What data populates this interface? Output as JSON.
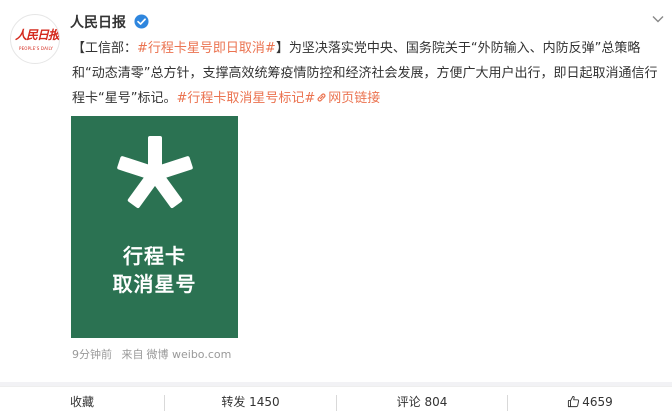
{
  "post": {
    "author": "人民日报",
    "avatar": {
      "logo_text": "人民日报",
      "logo_sub": "PEOPLE'S DAILY"
    },
    "text": {
      "bracket_open": "【",
      "source": "工信部：",
      "hashtag_main": "#行程卡星号即日取消#",
      "bracket_close": "】",
      "body": "为坚决落实党中央、国务院关于“外防输入、内防反弹”总策略和“动态清零”总方针，支撑高效统筹疫情防控和经济社会发展，方便广大用户出行，即日起取消通信行程卡“星号”标记。",
      "hashtag_end": "#行程卡取消星号标记#",
      "web_link": "网页链接"
    },
    "image": {
      "symbol": "*",
      "line1": "行程卡",
      "line2": "取消星号",
      "bg_color": "#2b7252"
    },
    "meta": {
      "time": "9分钟前",
      "source_prefix": "来自",
      "source": "微博 weibo.com"
    }
  },
  "actions": {
    "favorite": "收藏",
    "repost": "转发 1450",
    "comment": "评论 804",
    "like": "4659"
  },
  "colors": {
    "link": "#eb7350",
    "verified": "#2e86de",
    "text": "#333333",
    "meta": "#999999"
  },
  "icons": [
    "verified-badge-icon",
    "chevron-down-icon",
    "link-icon",
    "thumbs-up-icon"
  ]
}
